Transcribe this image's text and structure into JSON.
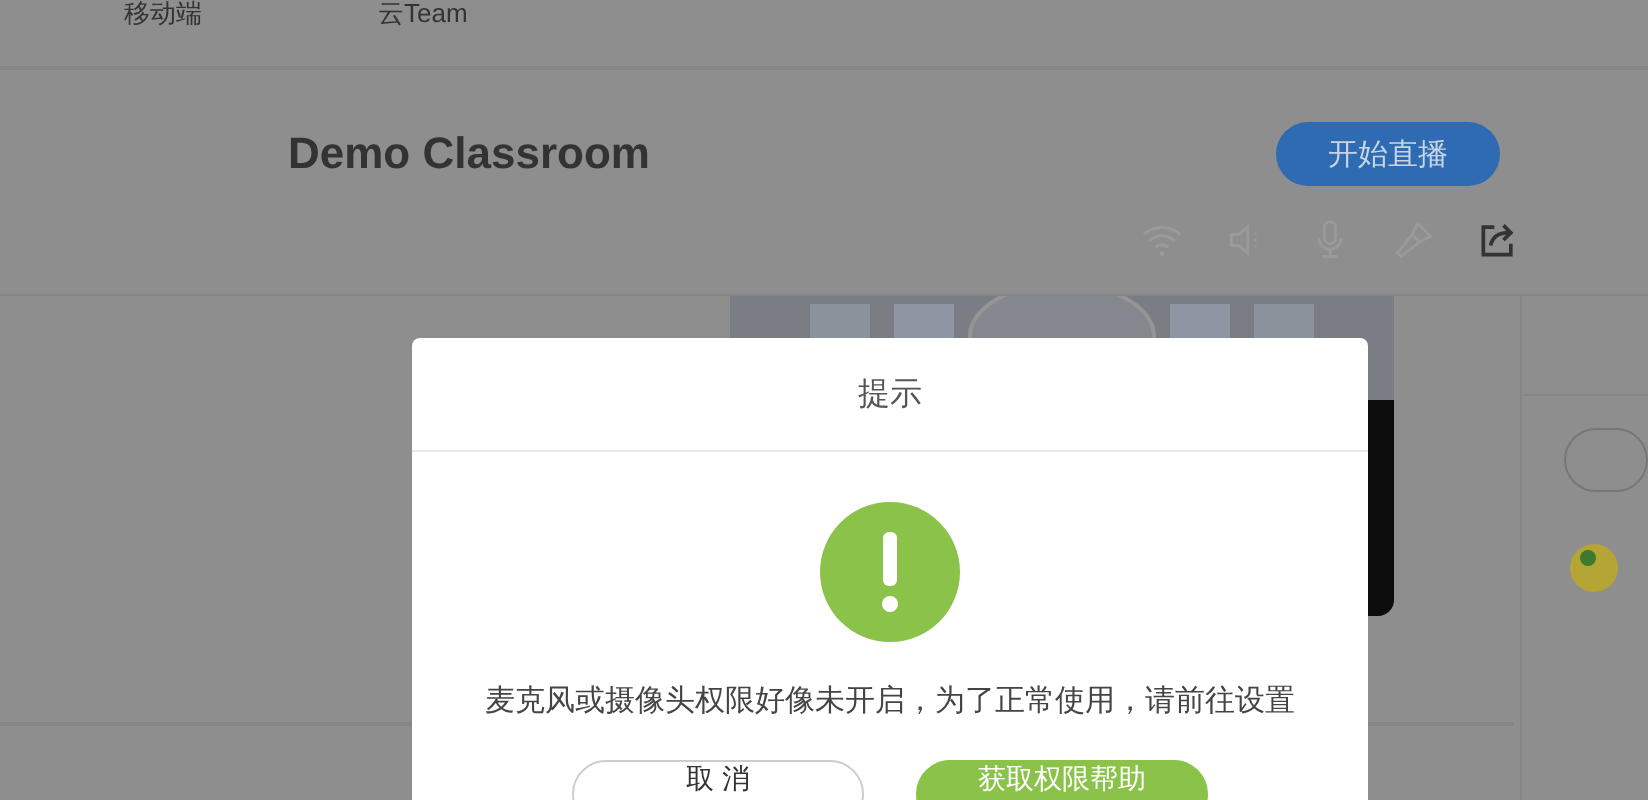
{
  "top_nav": [
    {
      "label": "移动端"
    },
    {
      "label": "云Team"
    }
  ],
  "header": {
    "title": "Demo Classroom",
    "start_button": "开始直播"
  },
  "dialog": {
    "title": "提示",
    "message": "麦克风或摄像头权限好像未开启，为了正常使用，请前往设置",
    "buttons": [
      {
        "label": "取 消",
        "kind": "secondary"
      },
      {
        "label": "获取权限帮助",
        "kind": "primary"
      }
    ]
  }
}
